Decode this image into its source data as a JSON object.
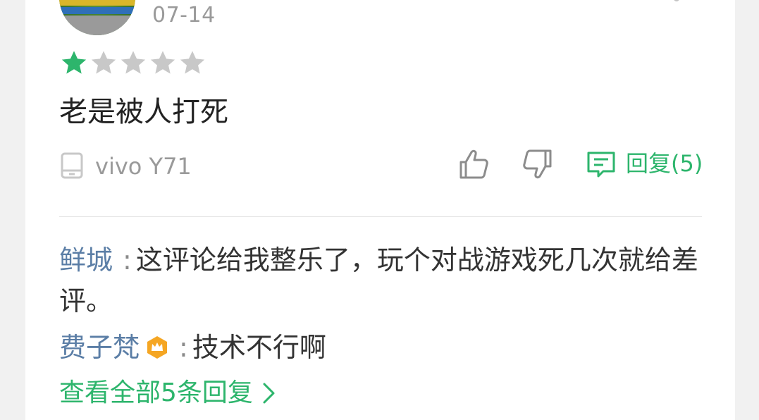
{
  "review": {
    "date": "07-14",
    "rating": 1,
    "max_rating": 5,
    "text": "老是被人打死",
    "device": "vivo Y71",
    "reply_label": "回复(5)"
  },
  "replies": [
    {
      "author": "鲜城",
      "separator": ":",
      "text": "这评论给我整乐了，玩个对战游戏死几次就给差评。",
      "vip": false
    },
    {
      "author": "费子梵",
      "separator": ":",
      "text": "技术不行啊",
      "vip": true
    }
  ],
  "view_all_label": "查看全部5条回复",
  "colors": {
    "accent_green": "#2db56c",
    "author_blue": "#5b7ea6",
    "star_empty": "#c8c8c8",
    "vip_badge": "#f5a623"
  },
  "icons": {
    "star": "star-icon",
    "device": "phone-icon",
    "like": "thumbs-up-icon",
    "dislike": "thumbs-down-icon",
    "reply": "comment-icon",
    "vip": "crown-badge-icon",
    "more": "chevron-right-icon"
  }
}
